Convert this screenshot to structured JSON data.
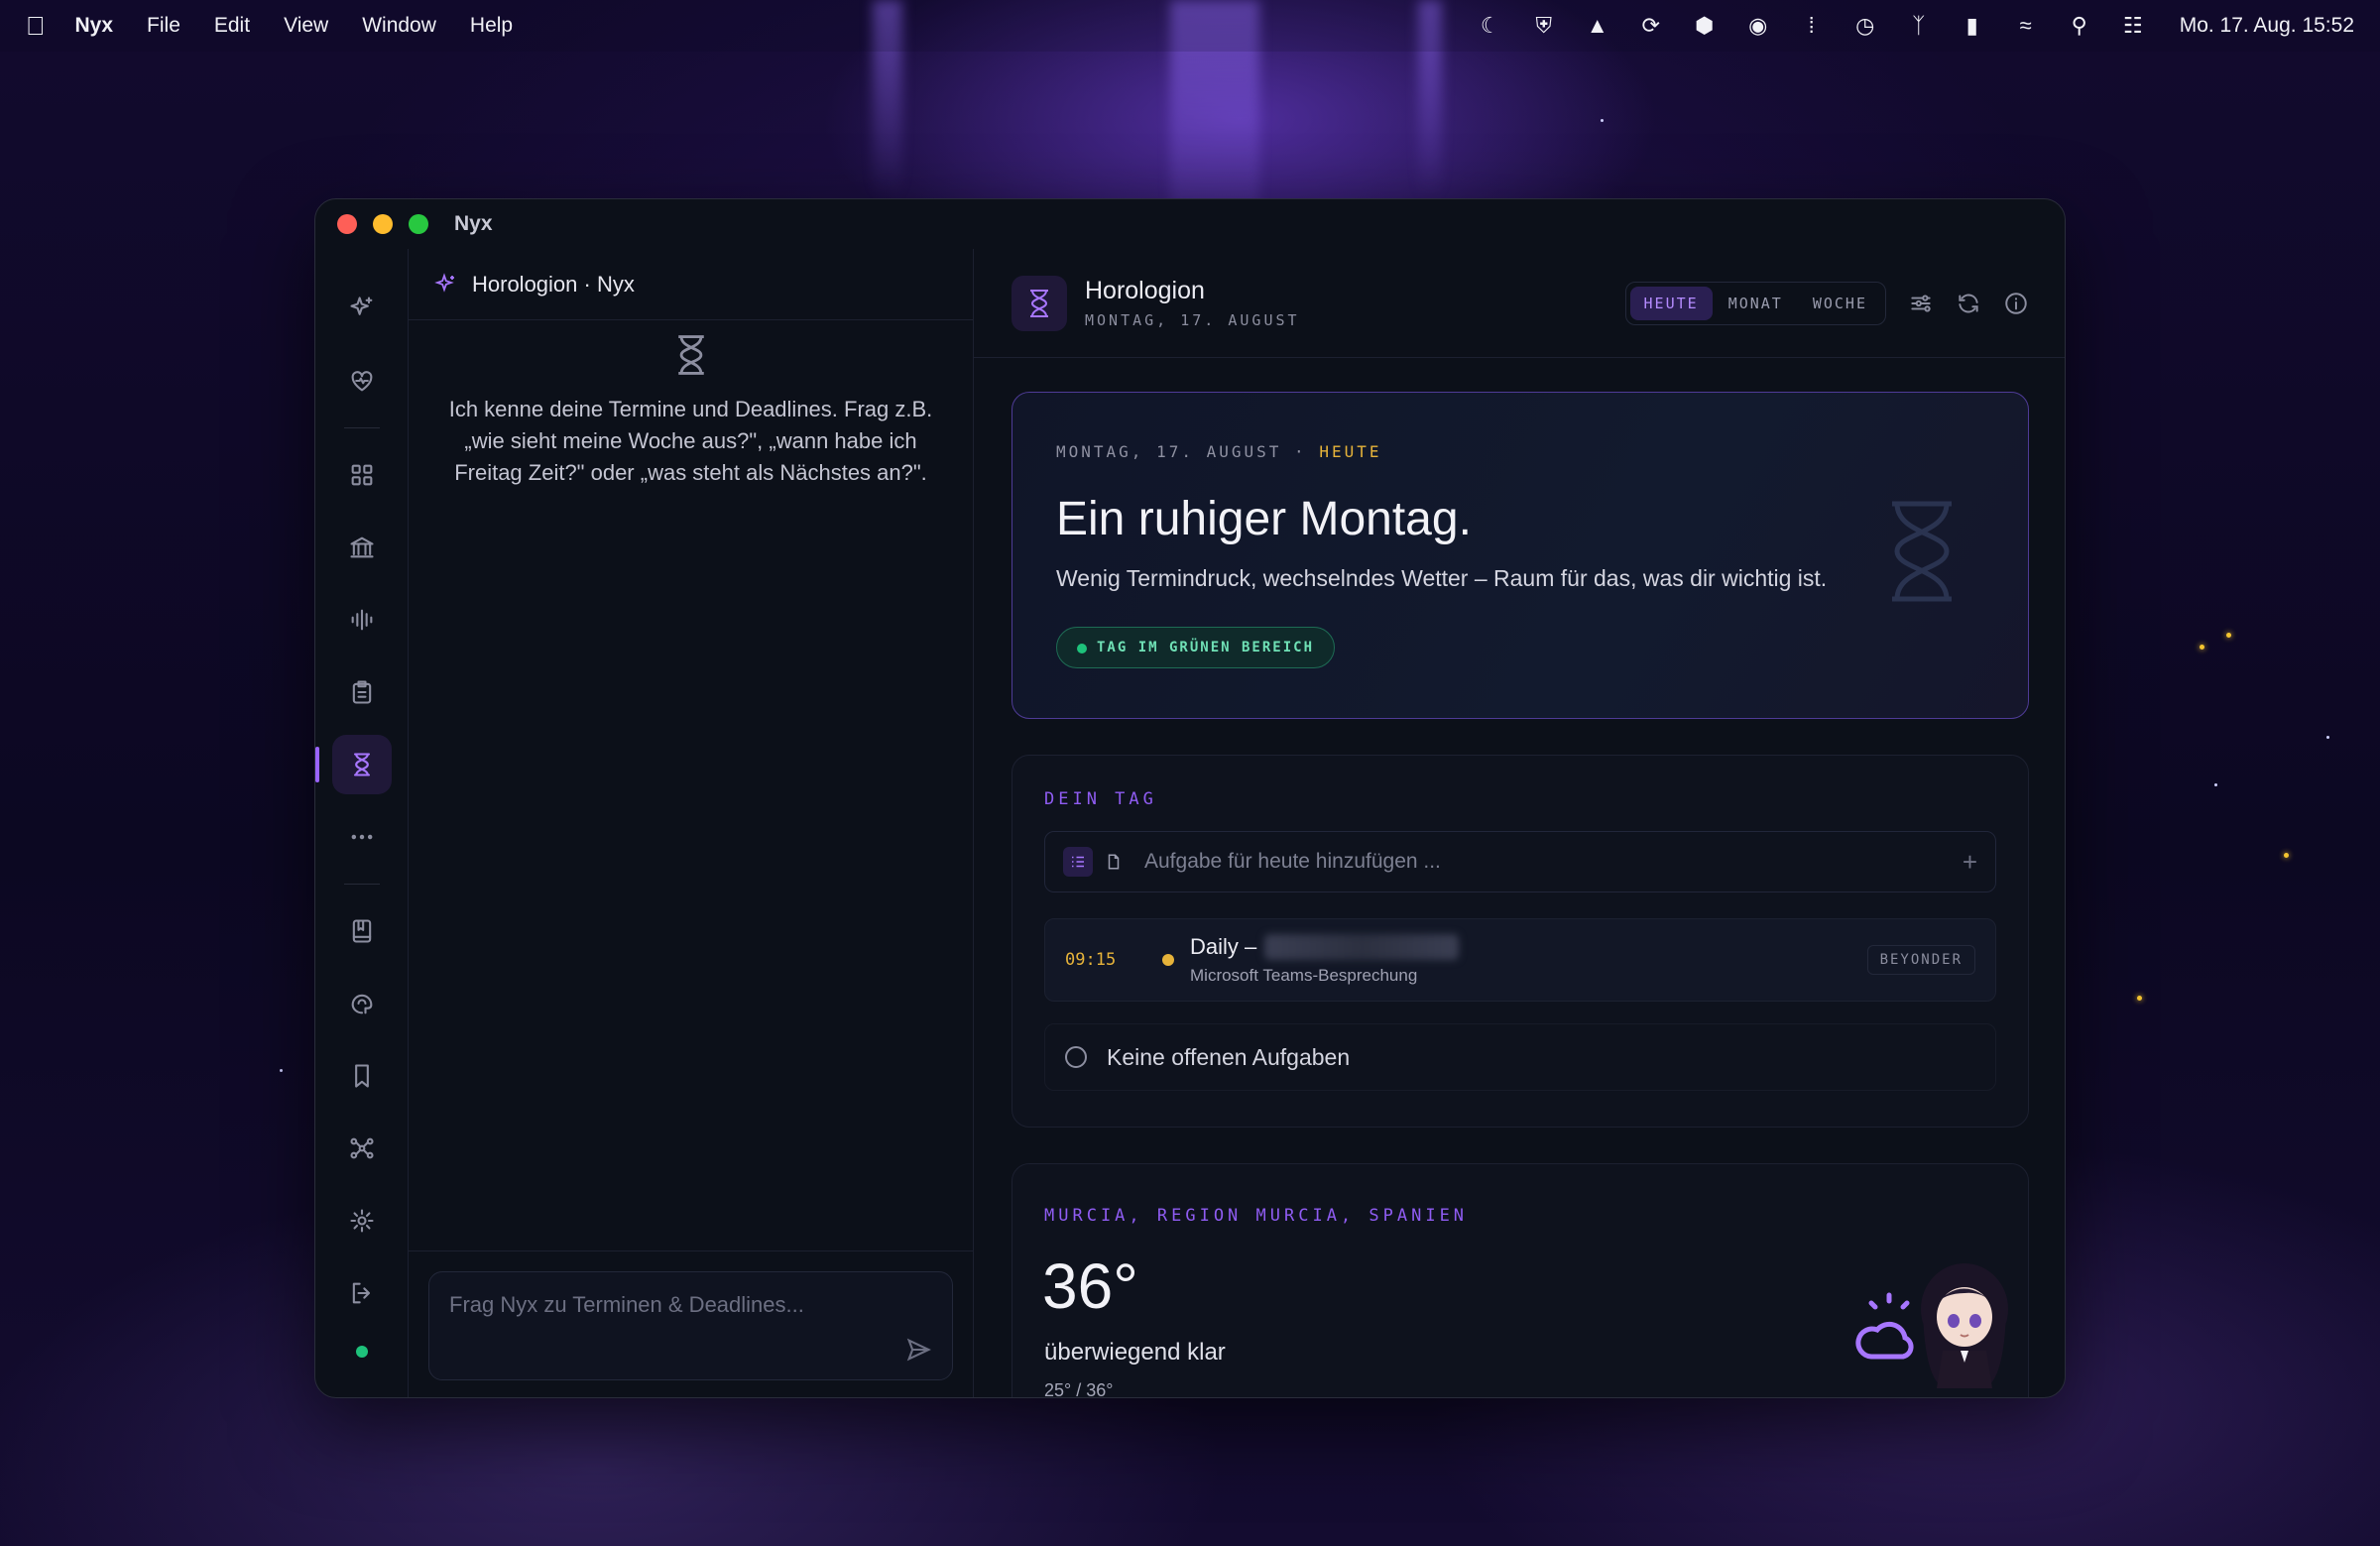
{
  "menubar": {
    "app": "Nyx",
    "items": [
      "File",
      "Edit",
      "View",
      "Window",
      "Help"
    ],
    "clock": "Mo. 17. Aug.  15:52"
  },
  "window": {
    "title": "Nyx"
  },
  "chat": {
    "title": "Horologion · Nyx",
    "empty_text": "Ich kenne deine Termine und Deadlines. Frag z.B. „wie sieht meine Woche aus?\", „wann habe ich Freitag Zeit?\" oder „was steht als Nächstes an?\".",
    "input_placeholder": "Frag Nyx zu Terminen & Deadlines..."
  },
  "header": {
    "title": "Horologion",
    "subtitle": "MONTAG, 17. AUGUST",
    "views": [
      "HEUTE",
      "MONAT",
      "WOCHE"
    ],
    "active_view": "HEUTE"
  },
  "hero": {
    "kicker": "MONTAG, 17. AUGUST",
    "kicker_sep": "·",
    "kicker_highlight": "HEUTE",
    "headline": "Ein ruhiger Montag.",
    "description": "Wenig Termindruck, wechselndes Wetter – Raum für das, was dir wichtig ist.",
    "status_pill": "TAG IM GRÜNEN BEREICH"
  },
  "day": {
    "label": "DEIN TAG",
    "add_placeholder": "Aufgabe für heute hinzufügen ...",
    "add_plus": "+",
    "event": {
      "time": "09:15",
      "title": "Daily –",
      "subtitle": "Microsoft Teams-Besprechung",
      "tag": "BEYONDER"
    },
    "tasks_empty": "Keine offenen Aufgaben"
  },
  "weather": {
    "location": "MURCIA, REGION MURCIA, SPANIEN",
    "temperature": "36°",
    "condition": "überwiegend klar",
    "range": "25° / 36°"
  },
  "colors": {
    "accent": "#9a63ff",
    "highlight": "#e6b33a",
    "ok": "#1ec27b"
  }
}
